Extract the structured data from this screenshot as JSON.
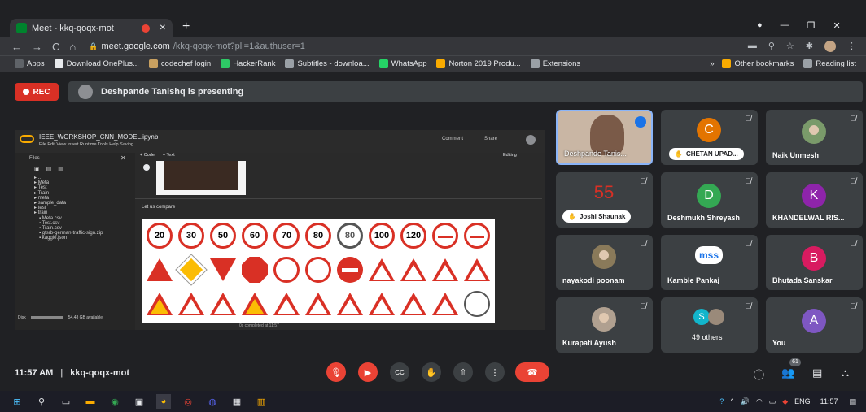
{
  "browser": {
    "tab_title": "Meet - kkq-qoqx-mot",
    "new_tab_symbol": "+",
    "url_host": "meet.google.com",
    "url_path": "/kkq-qoqx-mot?pli=1&authuser=1",
    "bookmarks": [
      {
        "label": "Apps",
        "color": "#5f6368"
      },
      {
        "label": "Download OnePlus...",
        "color": "#e8eaed"
      },
      {
        "label": "codechef login",
        "color": "#c8a060"
      },
      {
        "label": "HackerRank",
        "color": "#2ec866"
      },
      {
        "label": "Subtitles - downloa...",
        "color": "#9aa0a6"
      },
      {
        "label": "WhatsApp",
        "color": "#25d366"
      },
      {
        "label": "Norton 2019 Produ...",
        "color": "#f9ab00"
      },
      {
        "label": "Extensions",
        "color": "#9aa0a6"
      }
    ],
    "more_bookmarks": "»",
    "other_bookmarks": "Other bookmarks",
    "reading_list": "Reading list"
  },
  "meet": {
    "rec_label": "REC",
    "presenting_text": "Deshpande Tanishq is presenting",
    "time": "11:57 AM",
    "separator": "|",
    "meeting_code": "kkq-qoqx-mot",
    "people_count": "61"
  },
  "shared_screen": {
    "notebook_title": "IEEE_WORKSHOP_CNN_MODEL.ipynb",
    "menu": "File  Edit  View  Insert  Runtime  Tools  Help  Saving...",
    "comment": "Comment",
    "share": "Share",
    "files_header": "Files",
    "code_btn": "+ Code",
    "text_btn": "+ Text",
    "editing": "Editing",
    "tree": [
      "..",
      "Meta",
      "Test",
      "Train",
      "meta",
      "sample_data",
      "test",
      "train",
      "Meta.csv",
      "Test.csv",
      "Train.csv",
      "gtsrb-german-traffic-sign.zip",
      "kaggle.json"
    ],
    "markdown_text": "Let us compare",
    "status": "0s   completed at 11:57",
    "disk": "Disk",
    "disk_value": "54.48 GB available",
    "speed_labels": [
      "20",
      "30",
      "50",
      "60",
      "70",
      "80",
      "80",
      "100",
      "120"
    ]
  },
  "participants": [
    {
      "name": "Deshpande Tanis...",
      "type": "video",
      "bg": "#c9b6a4"
    },
    {
      "name": "CHETAN UPAD...",
      "type": "letter",
      "letter": "C",
      "color": "#e37400",
      "pill": true
    },
    {
      "name": "Naik Unmesh",
      "type": "photo",
      "color": "#7a9a6a"
    },
    {
      "name": "Joshi Shaunak",
      "type": "text-avatar",
      "letter": "55",
      "color": "#d93025",
      "pill": true
    },
    {
      "name": "Deshmukh Shreyash",
      "type": "letter",
      "letter": "D",
      "color": "#34a853"
    },
    {
      "name": "KHANDELWAL RIS...",
      "type": "letter",
      "letter": "K",
      "color": "#8e24aa"
    },
    {
      "name": "nayakodi poonam",
      "type": "photo",
      "color": "#8a7a5a"
    },
    {
      "name": "Kamble Pankaj",
      "type": "logo",
      "letter": "mss",
      "color": "#1a73e8"
    },
    {
      "name": "Bhutada Sanskar",
      "type": "letter",
      "letter": "B",
      "color": "#d81b60"
    },
    {
      "name": "Kurapati Ayush",
      "type": "photo",
      "color": "#b0a090"
    },
    {
      "name": "49 others",
      "type": "others",
      "letter": "S",
      "color": "#12b5cb"
    },
    {
      "name": "You",
      "type": "letter",
      "letter": "A",
      "color": "#7e57c2"
    }
  ],
  "taskbar": {
    "language": "ENG",
    "time": "11:57"
  }
}
